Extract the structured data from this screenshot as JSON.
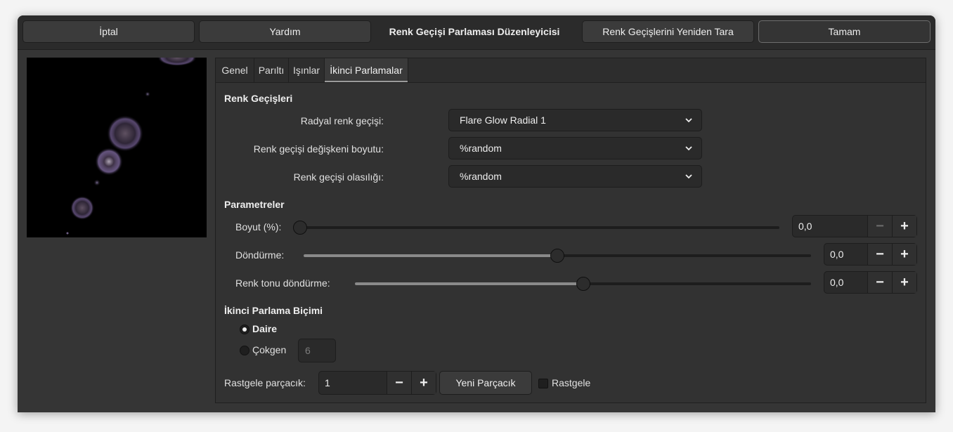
{
  "header": {
    "cancel_label": "İptal",
    "help_label": "Yardım",
    "title": "Renk Geçişi Parlaması Düzenleyicisi",
    "rescan_label": "Renk Geçişlerini Yeniden Tara",
    "ok_label": "Tamam"
  },
  "tabs": [
    {
      "label": "Genel"
    },
    {
      "label": "Parıltı"
    },
    {
      "label": "Işınlar"
    },
    {
      "label": "İkinci Parlamalar",
      "active": true
    }
  ],
  "gradients": {
    "heading": "Renk Geçişleri",
    "radial_label": "Radyal renk geçişi:",
    "radial_value": "Flare Glow Radial 1",
    "size_label": "Renk geçişi değişkeni boyutu:",
    "size_value": "%random",
    "prob_label": "Renk geçişi olasılığı:",
    "prob_value": "%random"
  },
  "parameters": {
    "heading": "Parametreler",
    "size_label": "Boyut (%):",
    "size_value": "0,0",
    "size_fraction": 0.0,
    "rotation_label": "Döndürme:",
    "rotation_value": "0,0",
    "rotation_fraction": 0.5,
    "hue_label": "Renk tonu döndürme:",
    "hue_value": "0,0",
    "hue_fraction": 0.5,
    "minus_glyph": "−",
    "plus_glyph": "+"
  },
  "shape": {
    "heading": "İkinci Parlama Biçimi",
    "circle_label": "Daire",
    "circle_selected": true,
    "polygon_label": "Çokgen",
    "polygon_sides": "6"
  },
  "random": {
    "seed_label": "Rastgele parçacık:",
    "seed_value": "1",
    "new_seed_label": "Yeni Parçacık",
    "randomize_label": "Rastgele",
    "randomize_checked": false
  },
  "icons": {
    "dropdown": "chevron-down-icon",
    "decrement": "minus-icon",
    "increment": "plus-icon"
  },
  "colors": {
    "window_bg": "#353535",
    "header_bg": "#2b2b2b",
    "flare_tint": "#b89ad6"
  }
}
